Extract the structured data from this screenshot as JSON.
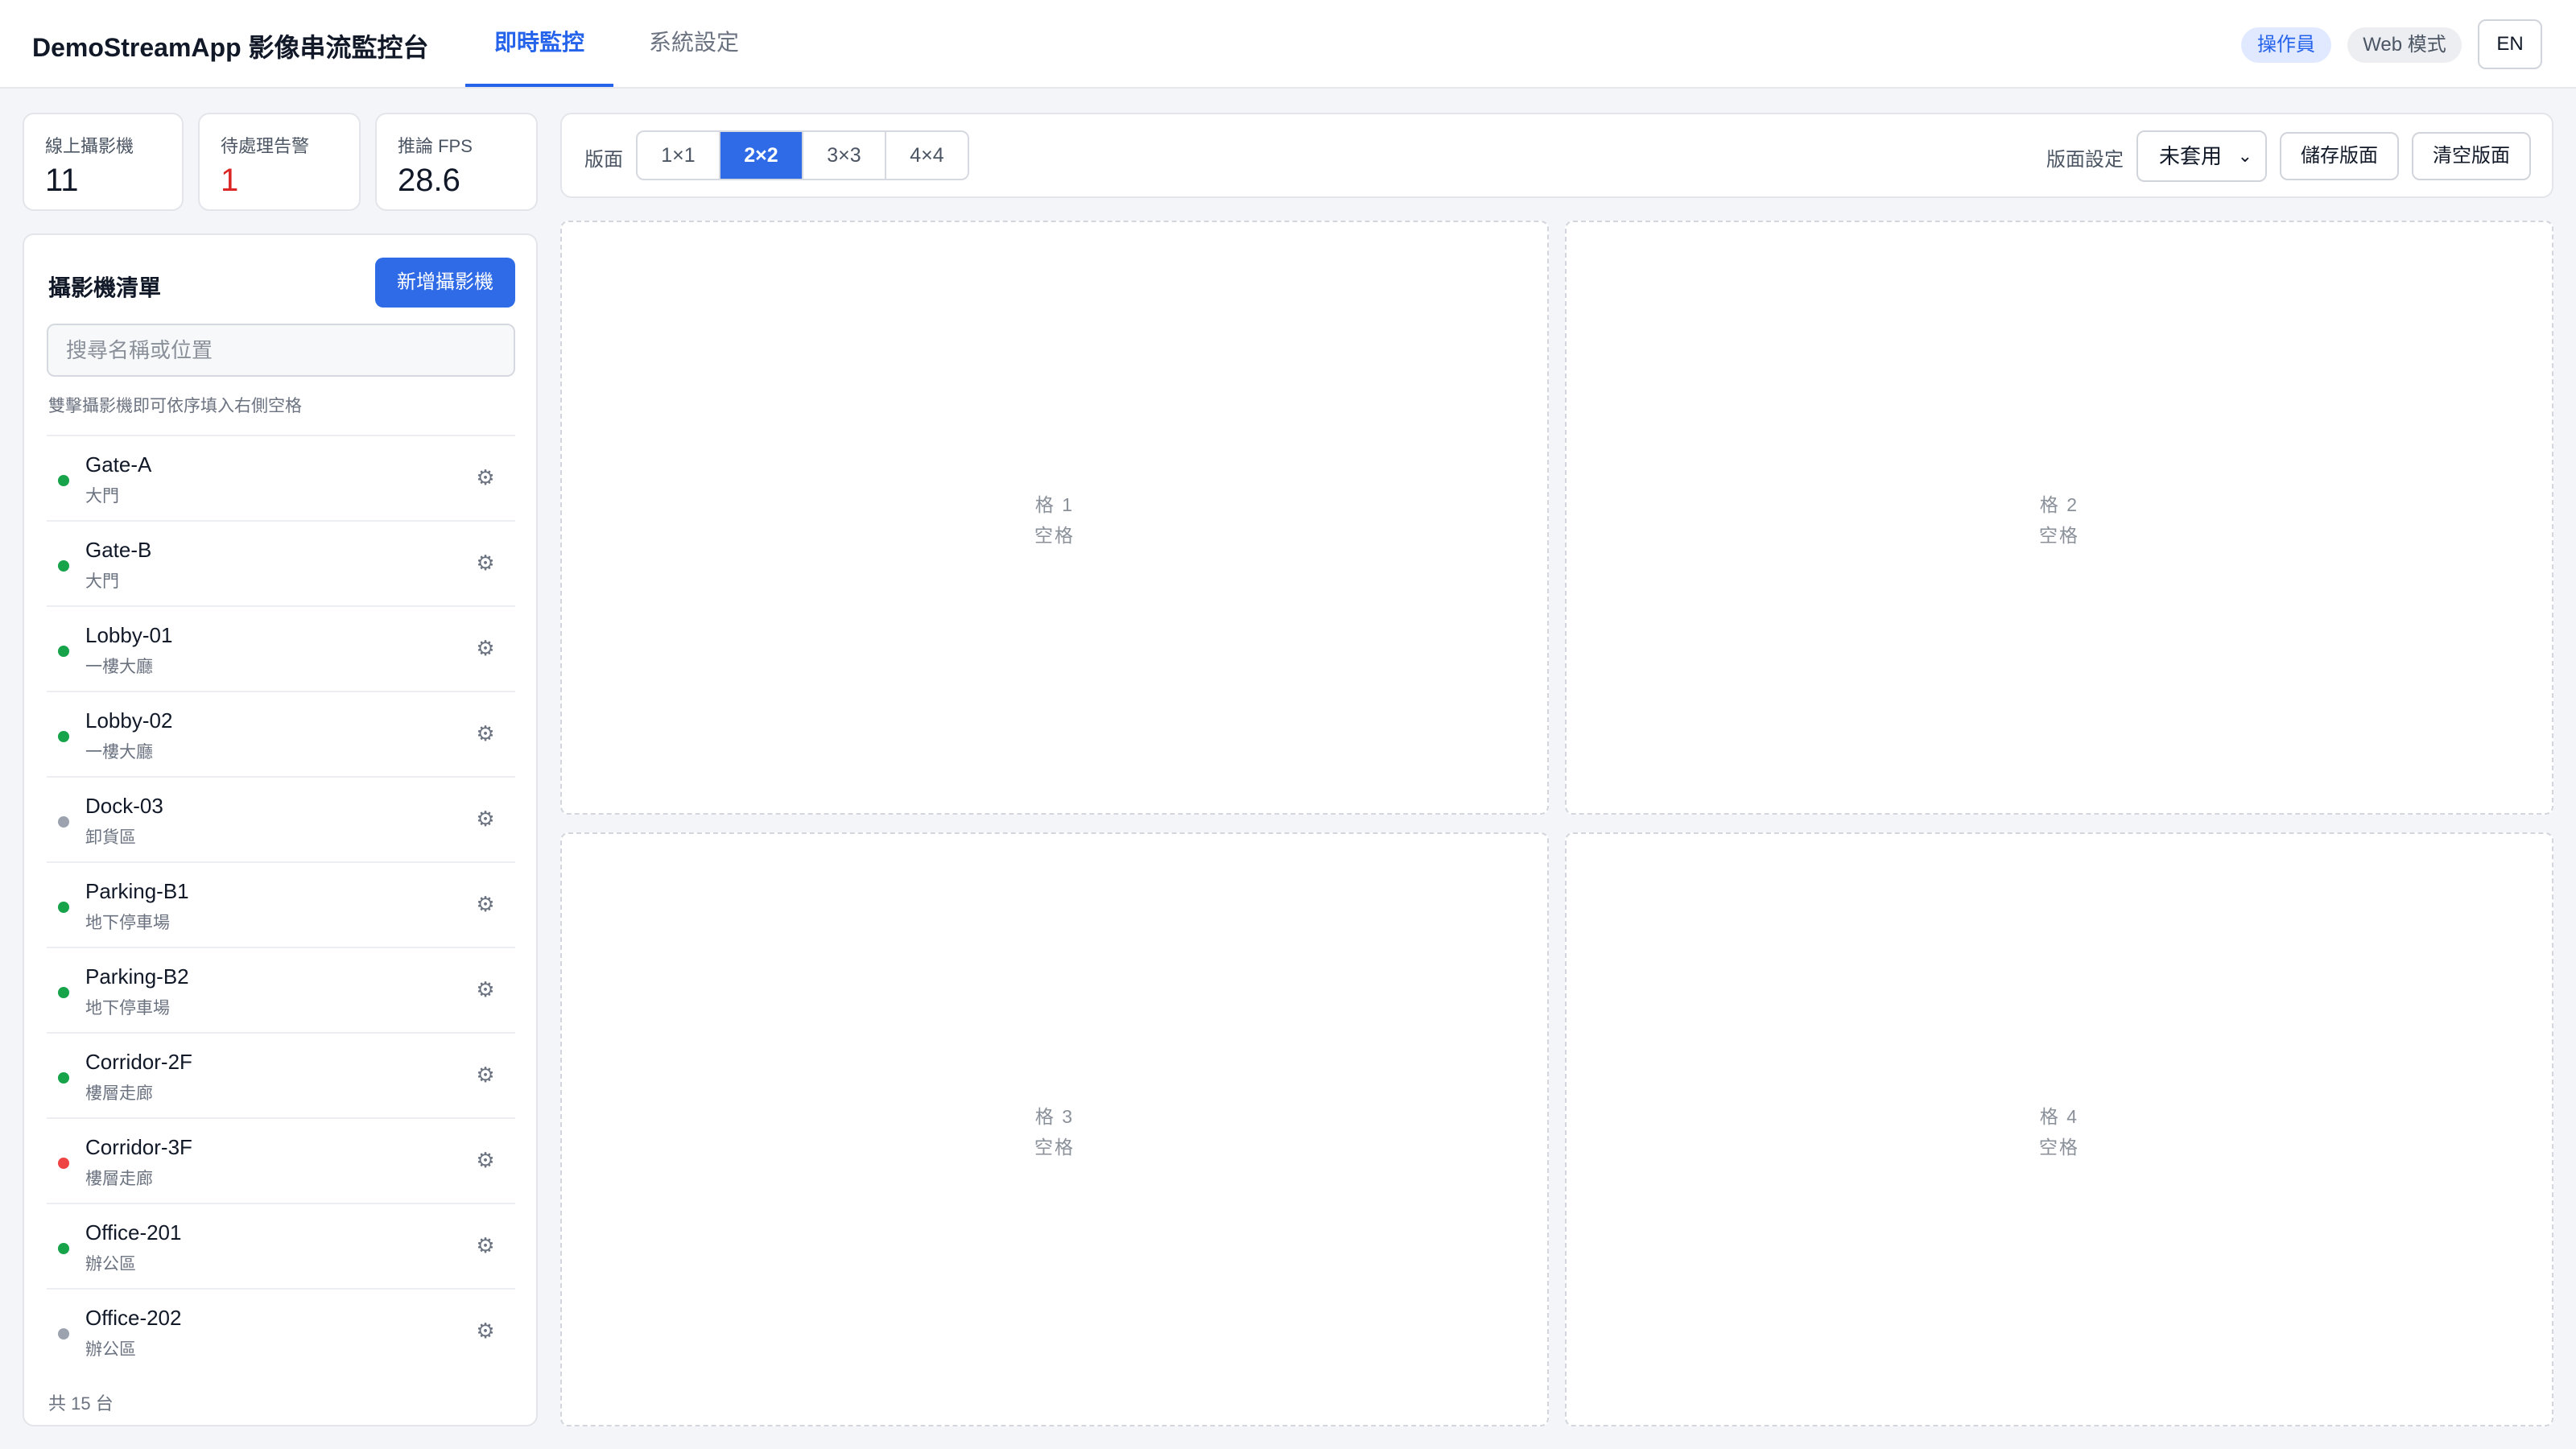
{
  "header": {
    "title": "DemoStreamApp 影像串流監控台",
    "tabs": [
      {
        "label": "即時監控",
        "active": true
      },
      {
        "label": "系統設定",
        "active": false
      }
    ],
    "role_badge": "操作員",
    "mode_badge": "Web 模式",
    "lang_button": "EN"
  },
  "stats": [
    {
      "label": "線上攝影機",
      "value": "11"
    },
    {
      "label": "待處理告警",
      "value": "1"
    },
    {
      "label": "推論 FPS",
      "value": "28.6"
    }
  ],
  "camera_panel": {
    "title": "攝影機清單",
    "add_button": "新增攝影機",
    "search_placeholder": "搜尋名稱或位置",
    "hint": "雙擊攝影機即可依序填入右側空格",
    "cameras": [
      {
        "name": "Gate-A",
        "location": "大門",
        "status": "online"
      },
      {
        "name": "Gate-B",
        "location": "大門",
        "status": "online"
      },
      {
        "name": "Lobby-01",
        "location": "一樓大廳",
        "status": "online"
      },
      {
        "name": "Lobby-02",
        "location": "一樓大廳",
        "status": "online"
      },
      {
        "name": "Dock-03",
        "location": "卸貨區",
        "status": "offline"
      },
      {
        "name": "Parking-B1",
        "location": "地下停車場",
        "status": "online"
      },
      {
        "name": "Parking-B2",
        "location": "地下停車場",
        "status": "online"
      },
      {
        "name": "Corridor-2F",
        "location": "樓層走廊",
        "status": "online"
      },
      {
        "name": "Corridor-3F",
        "location": "樓層走廊",
        "status": "alert"
      },
      {
        "name": "Office-201",
        "location": "辦公區",
        "status": "online"
      },
      {
        "name": "Office-202",
        "location": "辦公區",
        "status": "offline"
      }
    ],
    "total": "共 15 台"
  },
  "toolbar": {
    "layout_label": "版面",
    "layouts": [
      {
        "label": "1×1",
        "active": false
      },
      {
        "label": "2×2",
        "active": true
      },
      {
        "label": "3×3",
        "active": false
      },
      {
        "label": "4×4",
        "active": false
      }
    ],
    "preset_label": "版面設定",
    "preset_value": "未套用",
    "save_button": "儲存版面",
    "clear_button": "清空版面"
  },
  "grid": {
    "cells": [
      {
        "label": "格 1",
        "status": "空格"
      },
      {
        "label": "格 2",
        "status": "空格"
      },
      {
        "label": "格 3",
        "status": "空格"
      },
      {
        "label": "格 4",
        "status": "空格"
      }
    ]
  },
  "colors": {
    "accent": "#2f6be6",
    "online": "#16a34a",
    "offline": "#9ca3af",
    "alert": "#ef4444",
    "alert_value": "#dc2626"
  }
}
